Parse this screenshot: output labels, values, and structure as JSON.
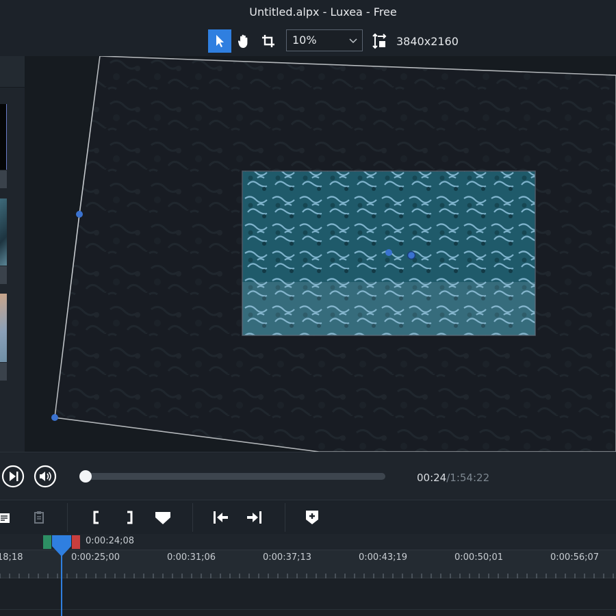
{
  "window": {
    "title": "Untitled.alpx - Luxea - Free"
  },
  "toolbar": {
    "zoom_value": "10%",
    "resolution": "3840x2160",
    "accent": "#2f7fe0"
  },
  "playback": {
    "current_time": "00:24",
    "total_time": "/1:54:22",
    "progress": 0.0
  },
  "timeline": {
    "playhead_time": "0:00:24;08",
    "ruler_labels": [
      "18;18",
      "0:00:25;00",
      "0:00:31;06",
      "0:00:37;13",
      "0:00:43;19",
      "0:00:50;01",
      "0:00:56;07"
    ]
  },
  "icons": {
    "select": "arrow-cursor-icon",
    "hand": "hand-pan-icon",
    "crop": "crop-icon",
    "aspect": "resolution-icon",
    "play": "play-next-icon",
    "volume": "volume-icon",
    "mark_in": "mark-in-icon",
    "mark_out": "mark-out-icon",
    "marker": "marker-icon",
    "go_start": "go-to-in-icon",
    "go_end": "go-to-out-icon",
    "add_marker": "add-marker-icon"
  }
}
